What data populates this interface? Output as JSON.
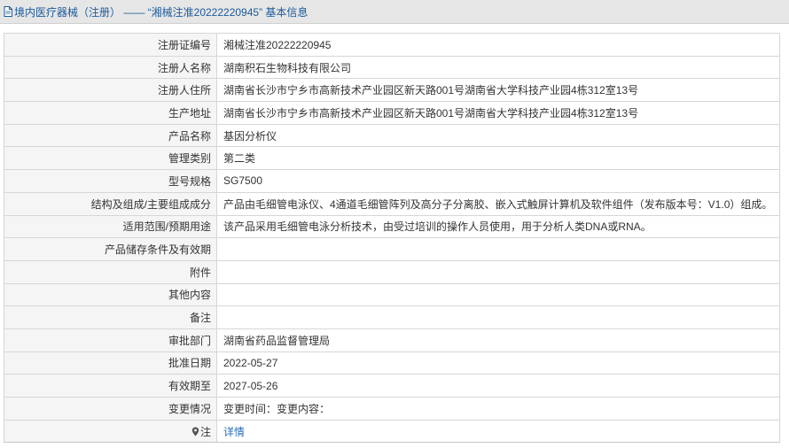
{
  "header": {
    "title": "境内医疗器械（注册） —— “湘械注准20222220945” 基本信息"
  },
  "rows": [
    {
      "label": "注册证编号",
      "value": "湘械注准20222220945"
    },
    {
      "label": "注册人名称",
      "value": "湖南积石生物科技有限公司"
    },
    {
      "label": "注册人住所",
      "value": "湖南省长沙市宁乡市高新技术产业园区新天路001号湖南省大学科技产业园4栋312室13号"
    },
    {
      "label": "生产地址",
      "value": "湖南省长沙市宁乡市高新技术产业园区新天路001号湖南省大学科技产业园4栋312室13号"
    },
    {
      "label": "产品名称",
      "value": "基因分析仪"
    },
    {
      "label": "管理类别",
      "value": "第二类"
    },
    {
      "label": "型号规格",
      "value": "SG7500"
    },
    {
      "label": "结构及组成/主要组成成分",
      "value": "产品由毛细管电泳仪、4通道毛细管阵列及高分子分离胶、嵌入式触屏计算机及软件组件（发布版本号：V1.0）组成。"
    },
    {
      "label": "适用范围/预期用途",
      "value": "该产品采用毛细管电泳分析技术，由受过培训的操作人员使用，用于分析人类DNA或RNA。"
    },
    {
      "label": "产品储存条件及有效期",
      "value": ""
    },
    {
      "label": "附件",
      "value": ""
    },
    {
      "label": "其他内容",
      "value": ""
    },
    {
      "label": "备注",
      "value": ""
    },
    {
      "label": "审批部门",
      "value": "湖南省药品监督管理局"
    },
    {
      "label": "批准日期",
      "value": "2022-05-27"
    },
    {
      "label": "有效期至",
      "value": "2027-05-26"
    },
    {
      "label": "变更情况",
      "value": "变更时间：变更内容："
    }
  ],
  "note": {
    "label": "注",
    "icon": "pin-icon",
    "link_text": "详情"
  },
  "colors": {
    "header_bg": "#e6e6e6",
    "header_text": "#1a5a9c",
    "label_bg": "#f5f5f5",
    "border": "#d6d6d6",
    "link": "#2a6db5"
  }
}
